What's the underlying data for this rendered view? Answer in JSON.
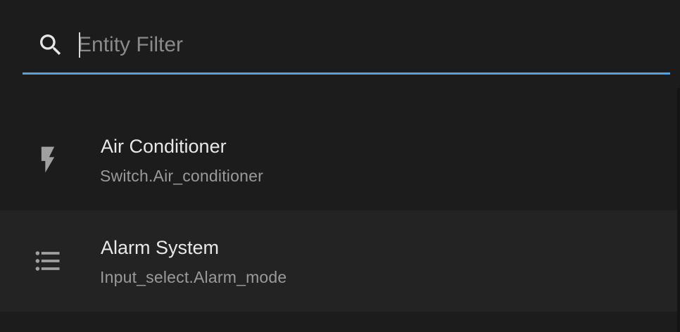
{
  "search": {
    "placeholder": "Entity Filter",
    "value": "",
    "icon": "magnify-icon",
    "underline_color": "#4aa3e8"
  },
  "entities": [
    {
      "title": "Air Conditioner",
      "entity_id": "Switch.Air_conditioner",
      "icon": "flash-icon"
    },
    {
      "title": "Alarm System",
      "entity_id": "Input_select.Alarm_mode",
      "icon": "format-list-bulleted-icon"
    }
  ],
  "colors": {
    "background": "#1c1c1c",
    "row_alt": "#232323",
    "primary_text": "#e8e8e8",
    "secondary_text": "#9a9a9a",
    "accent": "#4aa3e8"
  }
}
